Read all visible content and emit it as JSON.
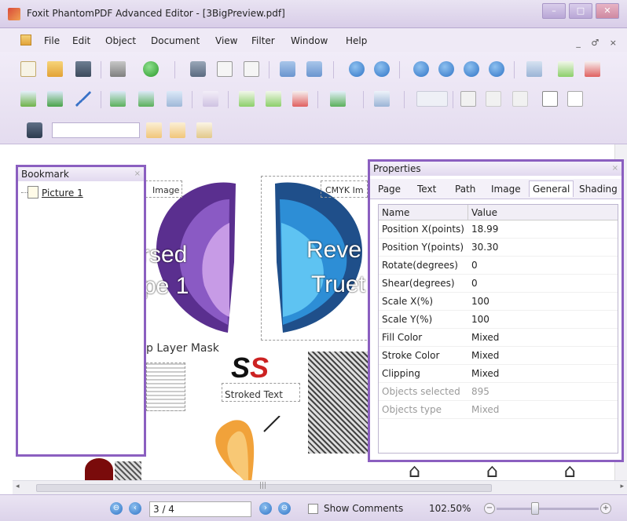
{
  "window": {
    "title": "Foxit PhantomPDF Advanced Editor - [3BigPreview.pdf]",
    "minimize": "–",
    "maximize": "□",
    "close": "✕"
  },
  "menu": {
    "items": [
      "File",
      "Edit",
      "Object",
      "Document",
      "View",
      "Filter",
      "Window",
      "Help"
    ],
    "mdi_controls": "_ ♂ ×"
  },
  "bookmark_panel": {
    "title": "Bookmark",
    "close": "×",
    "items": [
      {
        "label": "Picture 1"
      }
    ]
  },
  "page_content": {
    "top_left_label": "Image",
    "top_right_label": "CMYK Im",
    "butterfly_left_text_1": "rsed",
    "butterfly_left_text_2": "pe 1",
    "butterfly_right_text_1": "Reve",
    "butterfly_right_text_2": "Truet",
    "layer_mask_label": "p Layer Mask",
    "ss_text": "SS",
    "stroked_text": "Stroked Text",
    "symbols": "⌂ ⌂ ⌂ ⌂"
  },
  "properties_panel": {
    "title": "Properties",
    "close": "×",
    "tabs": [
      "Page",
      "Text",
      "Path",
      "Image",
      "General",
      "Shading"
    ],
    "active_tab": "General",
    "columns": [
      "Name",
      "Value"
    ],
    "rows": [
      {
        "name": "Position X(points)",
        "value": "18.99"
      },
      {
        "name": "Position Y(points)",
        "value": "30.30"
      },
      {
        "name": "Rotate(degrees)",
        "value": "0"
      },
      {
        "name": "Shear(degrees)",
        "value": "0"
      },
      {
        "name": "Scale X(%)",
        "value": "100"
      },
      {
        "name": "Scale Y(%)",
        "value": "100"
      },
      {
        "name": "Fill Color",
        "value": "Mixed"
      },
      {
        "name": "Stroke Color",
        "value": "Mixed"
      },
      {
        "name": "Clipping",
        "value": "Mixed"
      },
      {
        "name": "Objects selected",
        "value": "895"
      },
      {
        "name": "Objects type",
        "value": "Mixed"
      }
    ]
  },
  "statusbar": {
    "page_value": "3 / 4",
    "show_comments": "Show Comments",
    "zoom": "102.50%",
    "zoom_minus": "−",
    "zoom_plus": "+"
  },
  "colors": {
    "panel_border": "#8b5fc0",
    "chrome": "#e4dcef"
  }
}
